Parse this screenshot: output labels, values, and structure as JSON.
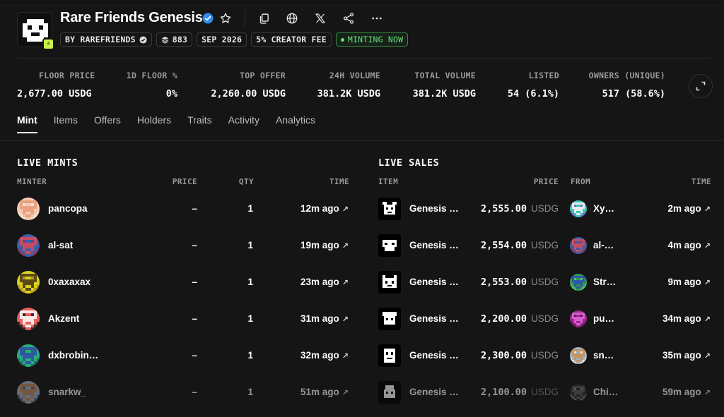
{
  "collection": {
    "title": "Rare Friends Genesis",
    "tags": {
      "creator": "BY RAREFRIENDS",
      "supply": "883",
      "date": "SEP 2026",
      "fee": "5% CREATOR FEE",
      "status": "MINTING NOW"
    },
    "header_icons": [
      "star-icon",
      "copy-icon",
      "globe-icon",
      "x-icon",
      "share-icon",
      "more-icon"
    ],
    "accent": "#c9f24b"
  },
  "stats": [
    {
      "label": "FLOOR PRICE",
      "value": "2,677.00 USDG"
    },
    {
      "label": "1D FLOOR %",
      "value": "0%"
    },
    {
      "label": "TOP OFFER",
      "value": "2,260.00 USDG"
    },
    {
      "label": "24H VOLUME",
      "value": "381.2K USDG"
    },
    {
      "label": "TOTAL VOLUME",
      "value": "381.2K USDG"
    },
    {
      "label": "LISTED",
      "value": "54 (6.1%)"
    },
    {
      "label": "OWNERS (UNIQUE)",
      "value": "517 (58.6%)"
    }
  ],
  "tabs": [
    "Mint",
    "Items",
    "Offers",
    "Holders",
    "Traits",
    "Activity",
    "Analytics"
  ],
  "live_mints": {
    "title": "LIVE MINTS",
    "columns": {
      "minter": "MINTER",
      "price": "PRICE",
      "qty": "QTY",
      "time": "TIME"
    },
    "rows": [
      {
        "minter": "pancopa",
        "price": "–",
        "qty": "1",
        "time": "12m ago"
      },
      {
        "minter": "al-sat",
        "price": "–",
        "qty": "1",
        "time": "19m ago"
      },
      {
        "minter": "0xaxaxax",
        "price": "–",
        "qty": "1",
        "time": "23m ago"
      },
      {
        "minter": "Akzent",
        "price": "–",
        "qty": "1",
        "time": "31m ago"
      },
      {
        "minter": "dxbrobin…",
        "price": "–",
        "qty": "1",
        "time": "32m ago"
      },
      {
        "minter": "snarkw_",
        "price": "–",
        "qty": "1",
        "time": "51m ago"
      }
    ]
  },
  "live_sales": {
    "title": "LIVE SALES",
    "columns": {
      "item": "ITEM",
      "price": "PRICE",
      "from": "FROM",
      "time": "TIME"
    },
    "currency": "USDG",
    "rows": [
      {
        "item": "Genesis …",
        "price": "2,555.00",
        "from": "Xy…",
        "time": "2m ago"
      },
      {
        "item": "Genesis …",
        "price": "2,554.00",
        "from": "al-…",
        "time": "4m ago"
      },
      {
        "item": "Genesis …",
        "price": "2,553.00",
        "from": "Str…",
        "time": "9m ago"
      },
      {
        "item": "Genesis …",
        "price": "2,200.00",
        "from": "pu…",
        "time": "34m ago"
      },
      {
        "item": "Genesis …",
        "price": "2,300.00",
        "from": "sn…",
        "time": "35m ago"
      },
      {
        "item": "Genesis …",
        "price": "2,100.00",
        "from": "Chi…",
        "time": "59m ago"
      }
    ]
  }
}
